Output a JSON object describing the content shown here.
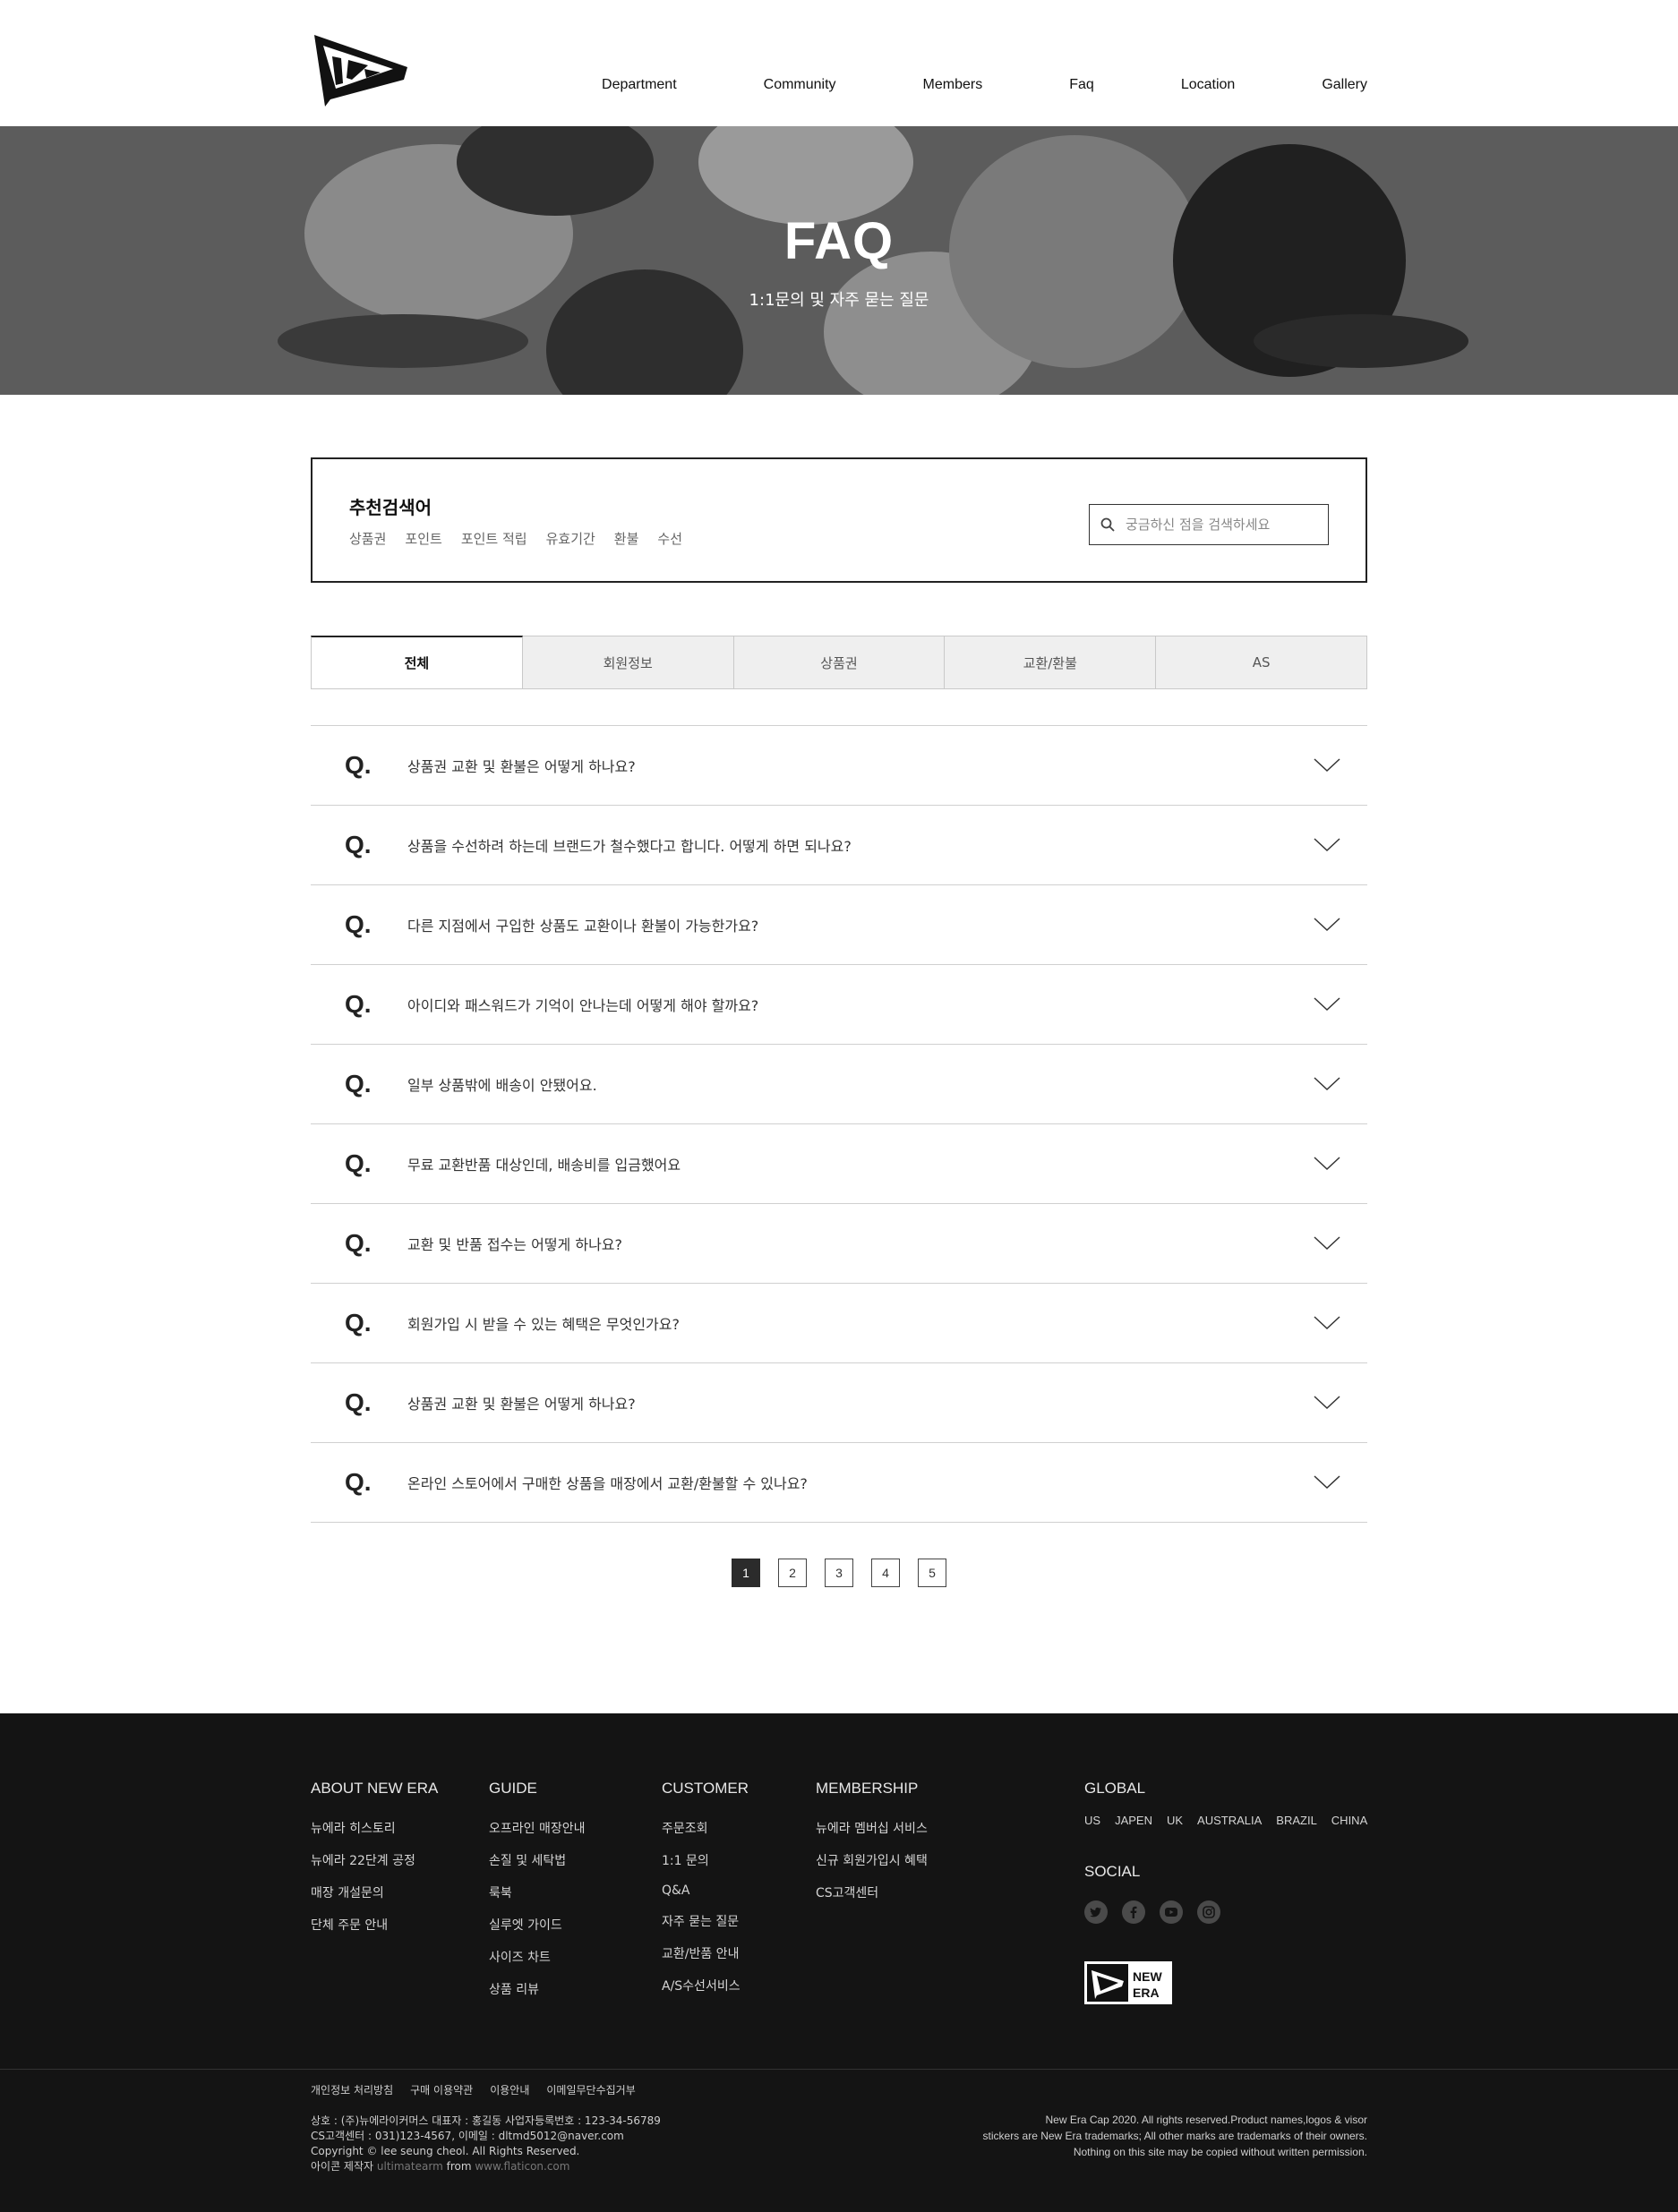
{
  "nav": [
    "Department",
    "Community",
    "Members",
    "Faq",
    "Location",
    "Gallery"
  ],
  "hero": {
    "title": "FAQ",
    "subtitle": "1:1문의 및 자주 묻는 질문"
  },
  "recommend": {
    "title": "추천검색어",
    "tags": [
      "상품권",
      "포인트",
      "포인트 적립",
      "유효기간",
      "환불",
      "수선"
    ]
  },
  "search": {
    "placeholder": "궁금하신 점을 검색하세요",
    "icon": "search-icon"
  },
  "tabs": [
    {
      "label": "전체",
      "active": true
    },
    {
      "label": "회원정보",
      "active": false
    },
    {
      "label": "상품권",
      "active": false
    },
    {
      "label": "교환/환불",
      "active": false
    },
    {
      "label": "AS",
      "active": false
    }
  ],
  "faq": {
    "q_mark": "Q.",
    "items": [
      "상품권 교환 및 환불은 어떻게 하나요?",
      "상품을 수선하려 하는데 브랜드가 철수했다고 합니다. 어떻게 하면 되나요?",
      "다른 지점에서 구입한 상품도 교환이나 환불이 가능한가요?",
      "아이디와 패스워드가 기억이 안나는데 어떻게 해야 할까요?",
      "일부 상품밖에 배송이 안됐어요.",
      "무료 교환반품 대상인데, 배송비를 입금했어요",
      "교환 및 반품 접수는 어떻게 하나요?",
      "회원가입 시 받을 수 있는 혜택은 무엇인가요?",
      "상품권 교환 및 환불은 어떻게 하나요?",
      "온라인 스토어에서 구매한 상품을 매장에서 교환/환불할 수 있나요?"
    ]
  },
  "pagination": {
    "pages": [
      "1",
      "2",
      "3",
      "4",
      "5"
    ],
    "current": "1"
  },
  "footer": {
    "columns": [
      {
        "title": "ABOUT NEW ERA",
        "items": [
          "뉴에라 히스토리",
          "뉴에라 22단계 공정",
          "매장 개설문의",
          "단체 주문 안내"
        ]
      },
      {
        "title": "GUIDE",
        "items": [
          "오프라인 매장안내",
          "손질 및 세탁법",
          "룩북",
          "실루엣 가이드",
          "사이즈 차트",
          "상품 리뷰"
        ]
      },
      {
        "title": "CUSTOMER",
        "items": [
          "주문조회",
          "1:1 문의",
          "Q&A",
          "자주 묻는 질문",
          "교환/반품 안내",
          "A/S수선서비스"
        ]
      },
      {
        "title": "MEMBERSHIP",
        "items": [
          "뉴에라 멤버십 서비스",
          "신규 회원가입시 혜택",
          "CS고객센터"
        ]
      }
    ],
    "global_title": "GLOBAL",
    "global_links": [
      "US",
      "JAPEN",
      "UK",
      "AUSTRALIA",
      "BRAZIL",
      "CHINA"
    ],
    "social_title": "SOCIAL",
    "social_icons": [
      "twitter-icon",
      "facebook-icon",
      "youtube-icon",
      "instagram-icon"
    ],
    "badge_text": [
      "NEW",
      "ERA"
    ],
    "legal_links": [
      "개인정보 처리방침",
      "구매 이용약관",
      "이용안내",
      "이메일무단수집거부"
    ],
    "company_lines": [
      "상호 : (주)뉴에라이커머스 대표자 : 홍길동 사업자등록번호 : 123-34-56789",
      "CS고객센터 : 031)123-4567, 이메일 : dltmd5012@naver.com",
      "Copyright © lee seung cheol. All Rights Reserved."
    ],
    "icon_credit": {
      "prefix": "아이콘 제작자",
      "author": "ultimatearm",
      "from": "from",
      "site": "www.flaticon.com"
    },
    "copyright_lines": [
      "New Era Cap 2020. All rights reserved.Product names,logos & visor",
      "stickers are New Era trademarks; All other marks are trademarks of their owners.",
      "Nothing on this site may be copied without written permission."
    ]
  }
}
